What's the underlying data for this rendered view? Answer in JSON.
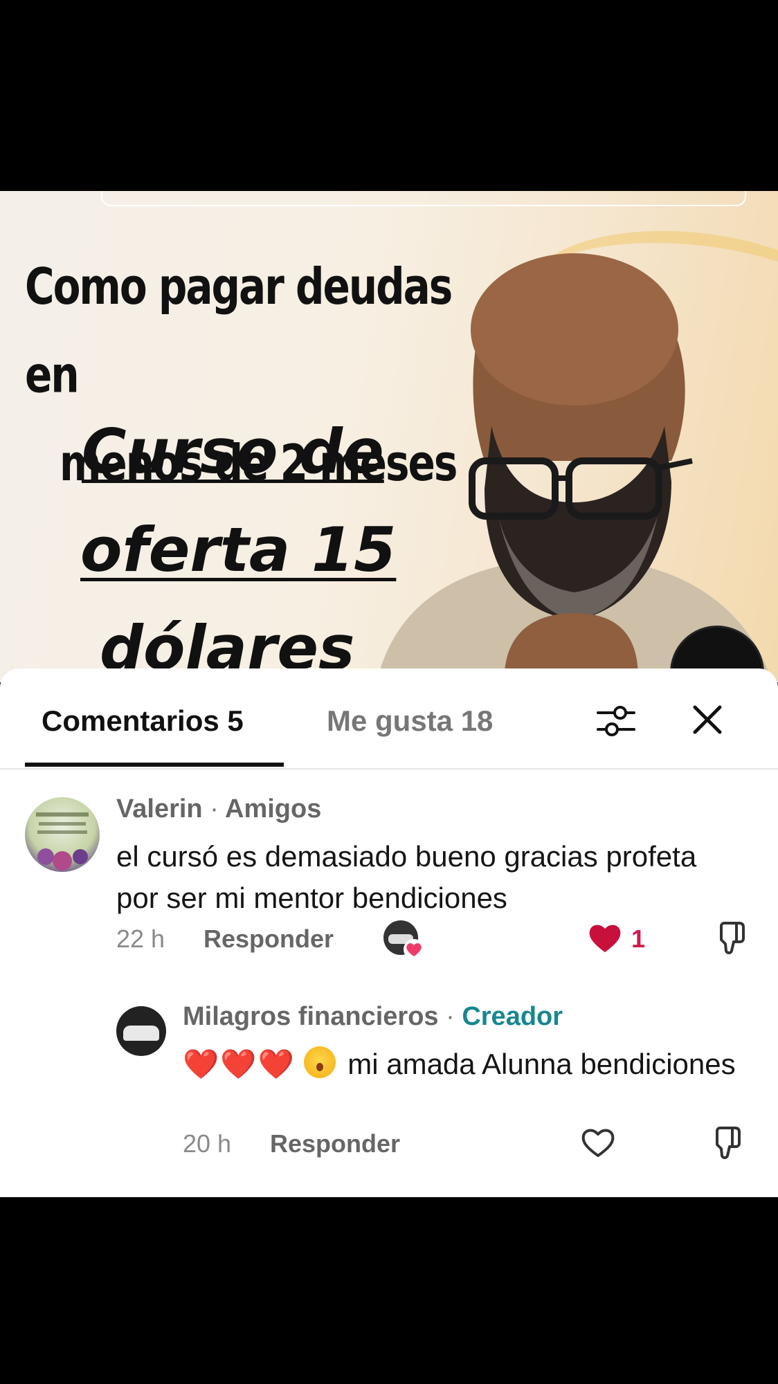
{
  "video": {
    "headline_line1": "Como pagar deudas en",
    "headline_line2": "menos de 2 meses",
    "promo_line1": "Curso de",
    "promo_line2": "oferta 15",
    "promo_line3": "dólares"
  },
  "tabs": {
    "comments_label": "Comentarios 5",
    "likes_label": "Me gusta 18"
  },
  "icons": {
    "filter": "filter-sliders-icon",
    "close": "close-icon",
    "like": "heart-icon",
    "dislike": "thumbs-down-icon"
  },
  "colors": {
    "creator_tag": "#17878f",
    "like_active": "#d11a4a"
  },
  "comments": [
    {
      "author": "Valerin",
      "separator": "·",
      "tag": "Amigos",
      "text": "el cursó es demasiado bueno gracias profeta por ser mi mentor bendiciones",
      "time": "22 h",
      "reply_label": "Responder",
      "likes": "1",
      "liked_by_creator": true,
      "liked": true
    },
    {
      "author": "Milagros financieros",
      "separator": "·",
      "tag": "Creador",
      "text_emoji": "❤️❤️❤️",
      "text": "mi amada Alunna bendiciones",
      "time": "20 h",
      "reply_label": "Responder",
      "liked": false
    }
  ]
}
